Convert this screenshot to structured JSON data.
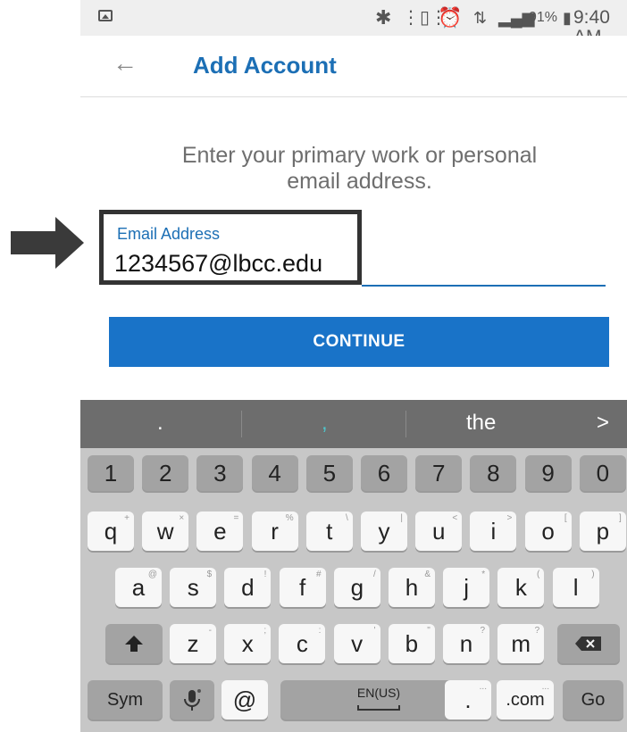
{
  "status_bar": {
    "battery": "91%",
    "time": "9:40 AM",
    "icons": [
      "image-icon",
      "bluetooth-icon",
      "vibrate-icon",
      "alarm-icon",
      "data-icon",
      "signal-icon",
      "battery-icon"
    ]
  },
  "app_bar": {
    "back_icon": "back-arrow-icon",
    "title": "Add Account"
  },
  "instruction": "Enter your primary work or personal email address.",
  "email": {
    "label": "Email Address",
    "value": "1234567@lbcc.edu"
  },
  "continue_label": "CONTINUE",
  "keyboard": {
    "suggestions": [
      ".",
      ",",
      "the"
    ],
    "suggestion_next_icon": "chevron-right-icon",
    "number_row": [
      "1",
      "2",
      "3",
      "4",
      "5",
      "6",
      "7",
      "8",
      "9",
      "0"
    ],
    "row1": [
      {
        "key": "q",
        "sub": "+"
      },
      {
        "key": "w",
        "sub": "×"
      },
      {
        "key": "e",
        "sub": "="
      },
      {
        "key": "r",
        "sub": "%"
      },
      {
        "key": "t",
        "sub": "\\"
      },
      {
        "key": "y",
        "sub": "|"
      },
      {
        "key": "u",
        "sub": "<"
      },
      {
        "key": "i",
        "sub": ">"
      },
      {
        "key": "o",
        "sub": "["
      },
      {
        "key": "p",
        "sub": "]"
      }
    ],
    "row2": [
      {
        "key": "a",
        "sub": "@"
      },
      {
        "key": "s",
        "sub": "$"
      },
      {
        "key": "d",
        "sub": "!"
      },
      {
        "key": "f",
        "sub": "#"
      },
      {
        "key": "g",
        "sub": "/"
      },
      {
        "key": "h",
        "sub": "&"
      },
      {
        "key": "j",
        "sub": "*"
      },
      {
        "key": "k",
        "sub": "("
      },
      {
        "key": "l",
        "sub": ")"
      }
    ],
    "row3": [
      {
        "key": "z",
        "sub": "-"
      },
      {
        "key": "x",
        "sub": ";"
      },
      {
        "key": "c",
        "sub": ":"
      },
      {
        "key": "v",
        "sub": "'"
      },
      {
        "key": "b",
        "sub": "\""
      },
      {
        "key": "n",
        "sub": "?"
      },
      {
        "key": "m",
        "sub": "?"
      }
    ],
    "sym": "Sym",
    "at": "@",
    "space_label": "EN(US)",
    "period": ".",
    "period_sub": "...",
    "dotcom": ".com",
    "dotcom_sub": "...",
    "go": "Go"
  }
}
